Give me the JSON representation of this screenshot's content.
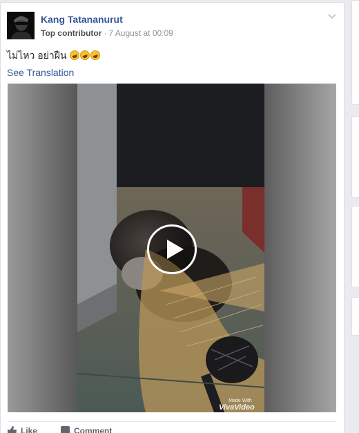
{
  "post": {
    "author": "Kang Tatananurut",
    "badge": "Top contributor",
    "separator": "·",
    "timestamp": "7 August at 00:09",
    "text": "ไม่ไหว อย่าฝืน",
    "emojis": [
      "rolling-on-floor-laughing",
      "rolling-on-floor-laughing",
      "rolling-on-floor-laughing"
    ],
    "see_translation": "See Translation"
  },
  "video": {
    "watermark_small": "Made With",
    "watermark_brand": "VivaVideo",
    "play_icon": "play-icon"
  },
  "actions": {
    "like_label": "Like",
    "comment_label": "Comment"
  },
  "colors": {
    "link": "#365899",
    "background": "#e9ebee"
  }
}
